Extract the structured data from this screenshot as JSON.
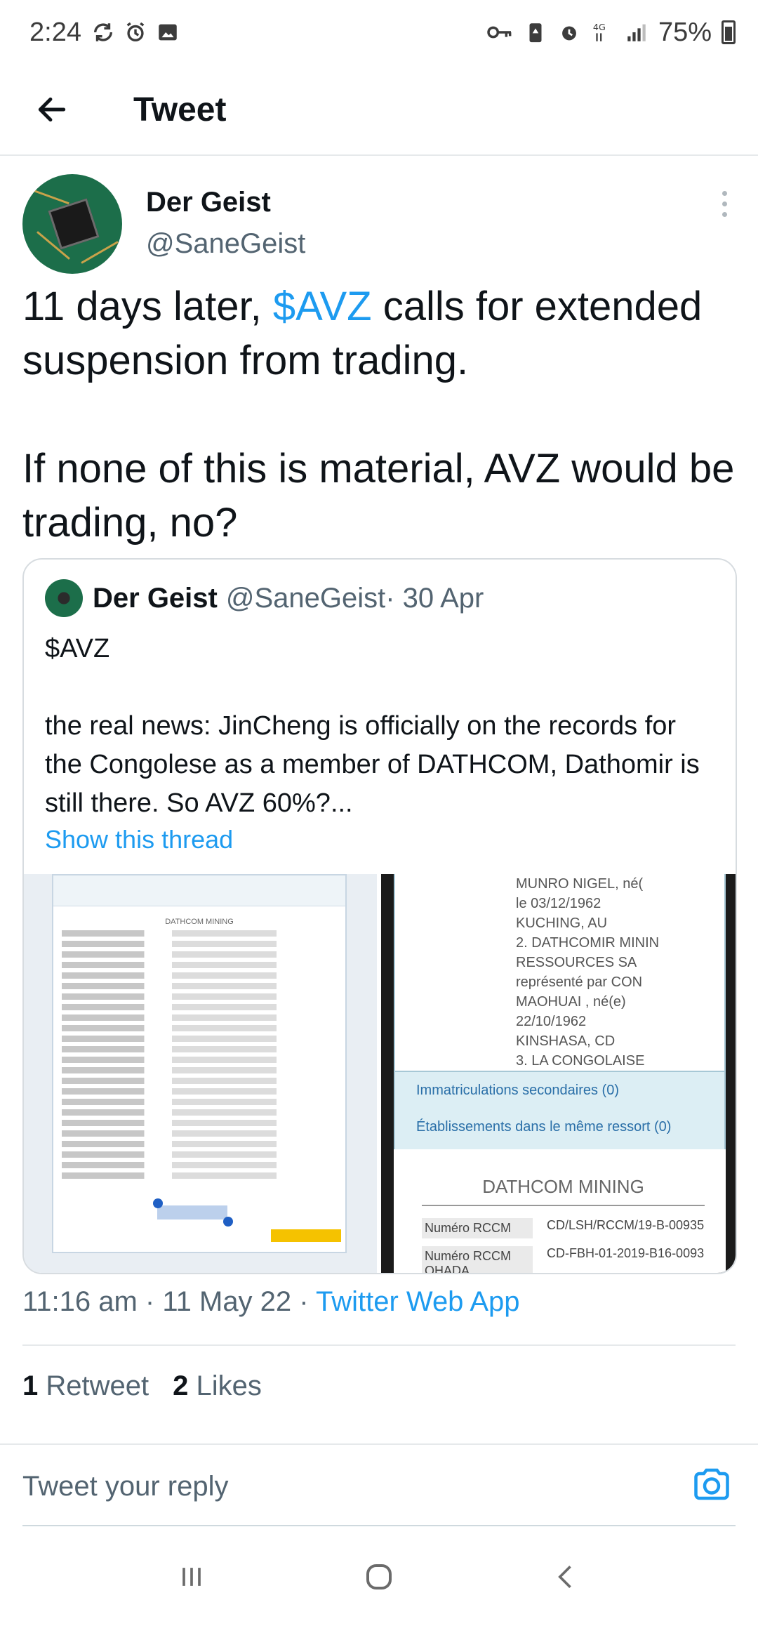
{
  "status_bar": {
    "time": "2:24",
    "battery": "75%"
  },
  "header": {
    "title": "Tweet"
  },
  "tweet": {
    "author_name": "Der Geist",
    "author_handle": "@SaneGeist",
    "text_line1_prefix": "11 days later, ",
    "text_cashtag": "$AVZ",
    "text_line1_suffix": " calls for extended suspension from trading.",
    "text_para2": "If none of this is material, AVZ would be trading, no?",
    "timestamp": "11:16 am · 11 May 22 · ",
    "source_app": "Twitter Web App",
    "retweets_count": "1",
    "retweets_label": "Retweet",
    "likes_count": "2",
    "likes_label": "Likes"
  },
  "quoted_tweet": {
    "author_name": "Der Geist",
    "author_handle": "@SaneGeist",
    "date": " · 30 Apr",
    "text_para1": "$AVZ",
    "text_para2": "the real news: JinCheng is officially on the records for the Congolese as a member of DATHCOM, Dathomir is still there. So AVZ 60%?...",
    "show_thread": "Show this thread",
    "image_right": {
      "lines": [
        "MUNRO NIGEL, né(",
        "le 03/12/1962",
        "KUCHING, AU",
        "2. DATHCOMIR MININ",
        "RESSOURCES SA",
        "représenté par CON",
        "MAOHUAI , né(e)",
        "22/10/1962",
        "KINSHASA, CD",
        "3. LA CONGOLAISE"
      ],
      "band1": "Immatriculations secondaires (0)",
      "band2": "Établissements dans le même ressort (0)",
      "title": "DATHCOM MINING",
      "row1_key": "Numéro RCCM",
      "row1_val": "CD/LSH/RCCM/19-B-00935",
      "row2_key": "Numéro RCCM OHADA",
      "row2_val": "CD-FBH-01-2019-B16-0093"
    },
    "image_left": {
      "title": "DATHCOM MINING"
    }
  },
  "reply": {
    "placeholder": "Tweet your reply"
  },
  "icons": {
    "back": "arrow-left-icon",
    "more": "more-vertical-icon",
    "camera": "camera-icon",
    "nav_recents": "recents-icon",
    "nav_home": "home-icon",
    "nav_back": "chevron-left-icon"
  },
  "colors": {
    "accent": "#1d9bf0",
    "secondary_text": "#536471"
  }
}
